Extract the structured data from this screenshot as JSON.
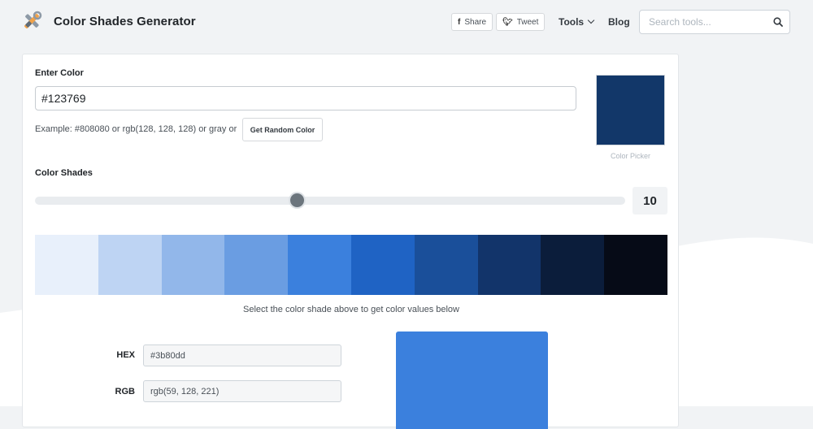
{
  "header": {
    "title": "Color Shades Generator",
    "share_label": "Share",
    "tweet_label": "Tweet",
    "tools_label": "Tools",
    "blog_label": "Blog",
    "search_placeholder": "Search tools..."
  },
  "form": {
    "enter_color_label": "Enter Color",
    "color_value": "#123769",
    "example_text": "Example: #808080 or rgb(128, 128, 128) or gray or",
    "random_button_label": "Get Random Color",
    "color_picker_label": "Color Picker",
    "swatch_color": "#123769"
  },
  "shades_section": {
    "label": "Color Shades",
    "shade_count": "10",
    "slider_value": 10,
    "slider_min": 2,
    "slider_max": 20,
    "shades": [
      "#e8f0fb",
      "#bed4f3",
      "#92b7ea",
      "#6a9de2",
      "#3b80dd",
      "#1f63c4",
      "#1a4f9a",
      "#12346a",
      "#0b1d3b",
      "#060b17"
    ],
    "hint": "Select the color shade above to get color values below"
  },
  "selected": {
    "hex_label": "HEX",
    "hex_value": "#3b80dd",
    "rgb_label": "RGB",
    "rgb_value": "rgb(59, 128, 221)",
    "preview_color": "#3b80dd"
  }
}
